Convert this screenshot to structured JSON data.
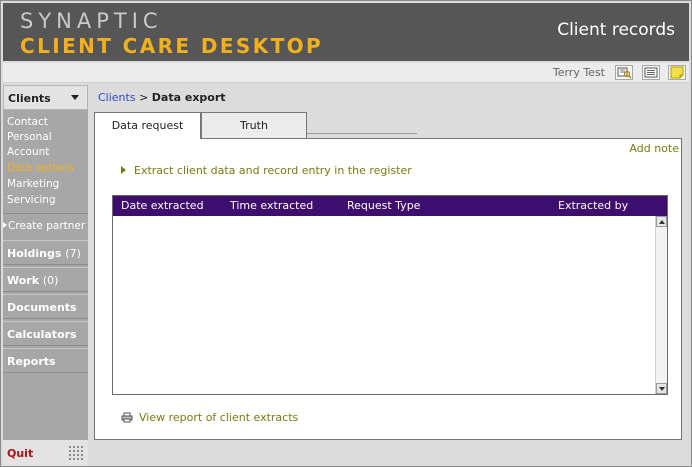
{
  "header": {
    "brand_line1": "SYNAPTIC",
    "brand_line2": "CLIENT CARE DESKTOP",
    "title": "Client records"
  },
  "topbar": {
    "user_name": "Terry Test",
    "icons": [
      "search-record-icon",
      "list-view-icon",
      "sticky-note-icon"
    ]
  },
  "sidebar": {
    "section_label": "Clients",
    "sub_items": [
      "Contact",
      "Personal",
      "Account",
      "Data options",
      "Marketing",
      "Servicing"
    ],
    "active_sub_item": "Data options",
    "create_partner": "Create partner",
    "nav": [
      {
        "label": "Holdings",
        "count": "(7)"
      },
      {
        "label": "Work",
        "count": "(0)"
      },
      {
        "label": "Documents",
        "count": ""
      },
      {
        "label": "Calculators",
        "count": ""
      },
      {
        "label": "Reports",
        "count": ""
      }
    ],
    "quit_label": "Quit"
  },
  "breadcrumb": {
    "link": "Clients",
    "separator": ">",
    "current": "Data export"
  },
  "tabs": [
    {
      "label": "Data request",
      "active": true
    },
    {
      "label": "Truth",
      "active": false
    }
  ],
  "panel": {
    "add_note": "Add note",
    "extract_link": "Extract client data and record entry in the register",
    "table": {
      "columns": [
        "Date extracted",
        "Time extracted",
        "Request Type",
        "Extracted by"
      ],
      "rows": []
    },
    "view_report": "View report of client extracts"
  },
  "colors": {
    "header_bg": "#565656",
    "brand_accent": "#f2b01e",
    "table_header_bg": "#3f0d6d",
    "link_olive": "#7a7a14",
    "sidebar_bg": "#a7a7a7",
    "quit_red": "#b01010",
    "breadcrumb_link": "#2b4ec4"
  }
}
